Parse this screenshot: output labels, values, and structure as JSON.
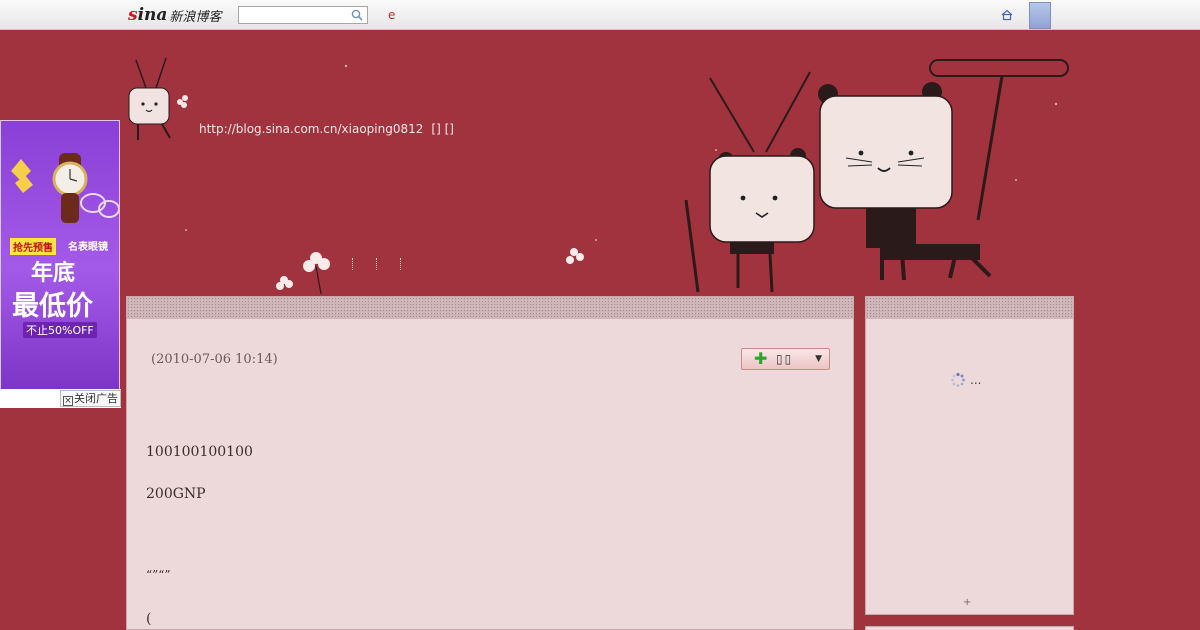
{
  "topbar": {
    "logo_text": "sina",
    "logo_suffix": "新浪博客",
    "search_placeholder": "",
    "e_link": "e",
    "home_icon": "home-icon",
    "search_icon": "magnifier-icon"
  },
  "banner": {
    "url": "http://blog.sina.com.cn/xiaoping0812",
    "links": "[] []"
  },
  "ad": {
    "badge_left": "抢先预售",
    "badge_right": "名表眼镜",
    "headline_1": "年底",
    "headline_2": "最低价",
    "discount": "不止50%OFF",
    "close_label": "关闭广告",
    "close_icon": "close-box-icon"
  },
  "article": {
    "date": "(2010-07-06 10:14)",
    "collect_label": "▯▯",
    "collect_icon": "plus-icon",
    "dropdown_icon": "triangle-down-icon",
    "paragraphs": [
      "100100100100",
      "200GNP",
      "“”“”",
      "("
    ]
  },
  "sidebar": {
    "loading_text": "...",
    "loading_icon": "spinner-icon",
    "plus": "+"
  },
  "colors": {
    "page_bg": "#a1333f",
    "panel_bg": "#edd9da",
    "accent_red": "#c62b22"
  }
}
